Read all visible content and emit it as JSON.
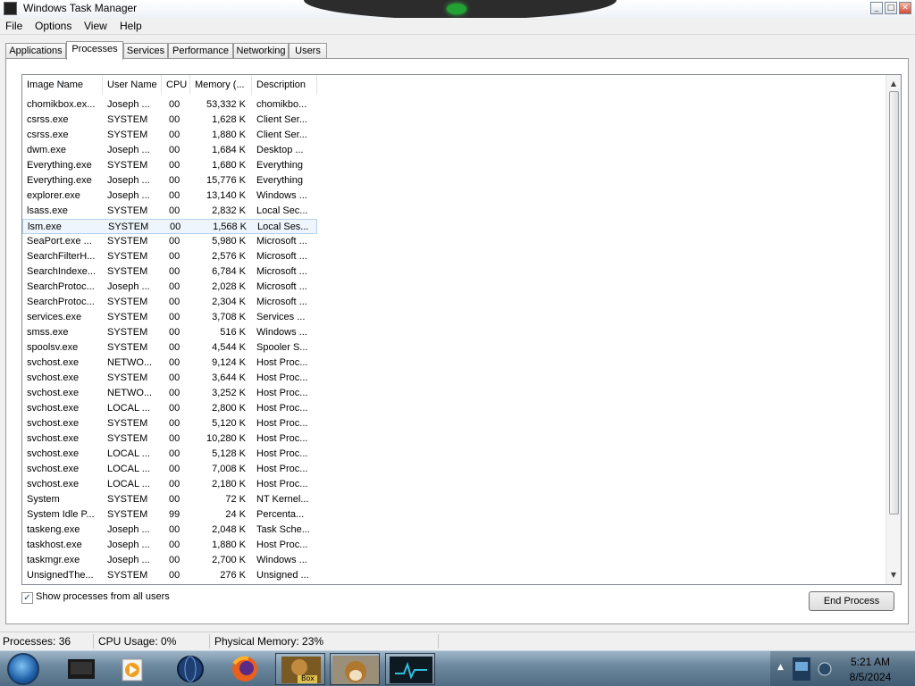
{
  "window": {
    "title": "Windows Task Manager"
  },
  "menu": [
    "File",
    "Options",
    "View",
    "Help"
  ],
  "tabs": [
    "Applications",
    "Processes",
    "Services",
    "Performance",
    "Networking",
    "Users"
  ],
  "active_tab": "Processes",
  "columns": [
    "Image Name",
    "User Name",
    "CPU",
    "Memory (...",
    "Description"
  ],
  "processes": [
    [
      "chomikbox.ex...",
      "Joseph ...",
      "00",
      "53,332 K",
      "chomikbo..."
    ],
    [
      "csrss.exe",
      "SYSTEM",
      "00",
      "1,628 K",
      "Client Ser..."
    ],
    [
      "csrss.exe",
      "SYSTEM",
      "00",
      "1,880 K",
      "Client Ser..."
    ],
    [
      "dwm.exe",
      "Joseph ...",
      "00",
      "1,684 K",
      "Desktop ..."
    ],
    [
      "Everything.exe",
      "SYSTEM",
      "00",
      "1,680 K",
      "Everything"
    ],
    [
      "Everything.exe",
      "Joseph ...",
      "00",
      "15,776 K",
      "Everything"
    ],
    [
      "explorer.exe",
      "Joseph ...",
      "00",
      "13,140 K",
      "Windows ..."
    ],
    [
      "lsass.exe",
      "SYSTEM",
      "00",
      "2,832 K",
      "Local Sec..."
    ],
    [
      "lsm.exe",
      "SYSTEM",
      "00",
      "1,568 K",
      "Local Ses..."
    ],
    [
      "SeaPort.exe ...",
      "SYSTEM",
      "00",
      "5,980 K",
      "Microsoft ..."
    ],
    [
      "SearchFilterH...",
      "SYSTEM",
      "00",
      "2,576 K",
      "Microsoft ..."
    ],
    [
      "SearchIndexe...",
      "SYSTEM",
      "00",
      "6,784 K",
      "Microsoft ..."
    ],
    [
      "SearchProtoc...",
      "Joseph ...",
      "00",
      "2,028 K",
      "Microsoft ..."
    ],
    [
      "SearchProtoc...",
      "SYSTEM",
      "00",
      "2,304 K",
      "Microsoft ..."
    ],
    [
      "services.exe",
      "SYSTEM",
      "00",
      "3,708 K",
      "Services ..."
    ],
    [
      "smss.exe",
      "SYSTEM",
      "00",
      "516 K",
      "Windows ..."
    ],
    [
      "spoolsv.exe",
      "SYSTEM",
      "00",
      "4,544 K",
      "Spooler S..."
    ],
    [
      "svchost.exe",
      "NETWO...",
      "00",
      "9,124 K",
      "Host Proc..."
    ],
    [
      "svchost.exe",
      "SYSTEM",
      "00",
      "3,644 K",
      "Host Proc..."
    ],
    [
      "svchost.exe",
      "NETWO...",
      "00",
      "3,252 K",
      "Host Proc..."
    ],
    [
      "svchost.exe",
      "LOCAL ...",
      "00",
      "2,800 K",
      "Host Proc..."
    ],
    [
      "svchost.exe",
      "SYSTEM",
      "00",
      "5,120 K",
      "Host Proc..."
    ],
    [
      "svchost.exe",
      "SYSTEM",
      "00",
      "10,280 K",
      "Host Proc..."
    ],
    [
      "svchost.exe",
      "LOCAL ...",
      "00",
      "5,128 K",
      "Host Proc..."
    ],
    [
      "svchost.exe",
      "LOCAL ...",
      "00",
      "7,008 K",
      "Host Proc..."
    ],
    [
      "svchost.exe",
      "LOCAL ...",
      "00",
      "2,180 K",
      "Host Proc..."
    ],
    [
      "System",
      "SYSTEM",
      "00",
      "72 K",
      "NT Kernel..."
    ],
    [
      "System Idle P...",
      "SYSTEM",
      "99",
      "24 K",
      "Percenta..."
    ],
    [
      "taskeng.exe",
      "Joseph ...",
      "00",
      "2,048 K",
      "Task Sche..."
    ],
    [
      "taskhost.exe",
      "Joseph ...",
      "00",
      "1,880 K",
      "Host Proc..."
    ],
    [
      "taskmgr.exe",
      "Joseph ...",
      "00",
      "2,700 K",
      "Windows ..."
    ],
    [
      "UnsignedThe...",
      "SYSTEM",
      "00",
      "276 K",
      "Unsigned ..."
    ]
  ],
  "selected_process": "lsm.exe",
  "show_all_users": {
    "label": "Show processes from all users",
    "checked": true
  },
  "end_process_label": "End Process",
  "status": {
    "processes": "Processes: 36",
    "cpu": "CPU Usage: 0%",
    "memory": "Physical Memory: 23%"
  },
  "taskbar": {
    "apps": [
      "start-orb-icon",
      "terminal-icon",
      "media-player-icon",
      "globe-icon",
      "firefox-icon",
      "chomikbox-icon",
      "hamster-icon",
      "task-manager-icon"
    ],
    "box_label": "Box",
    "time": "5:21 AM",
    "date": "8/5/2024"
  },
  "colors": {
    "selection": "#eef5fc",
    "selection_border": "#b3d2ee",
    "close_button": "#d24d34",
    "accent_green": "#21a334"
  }
}
